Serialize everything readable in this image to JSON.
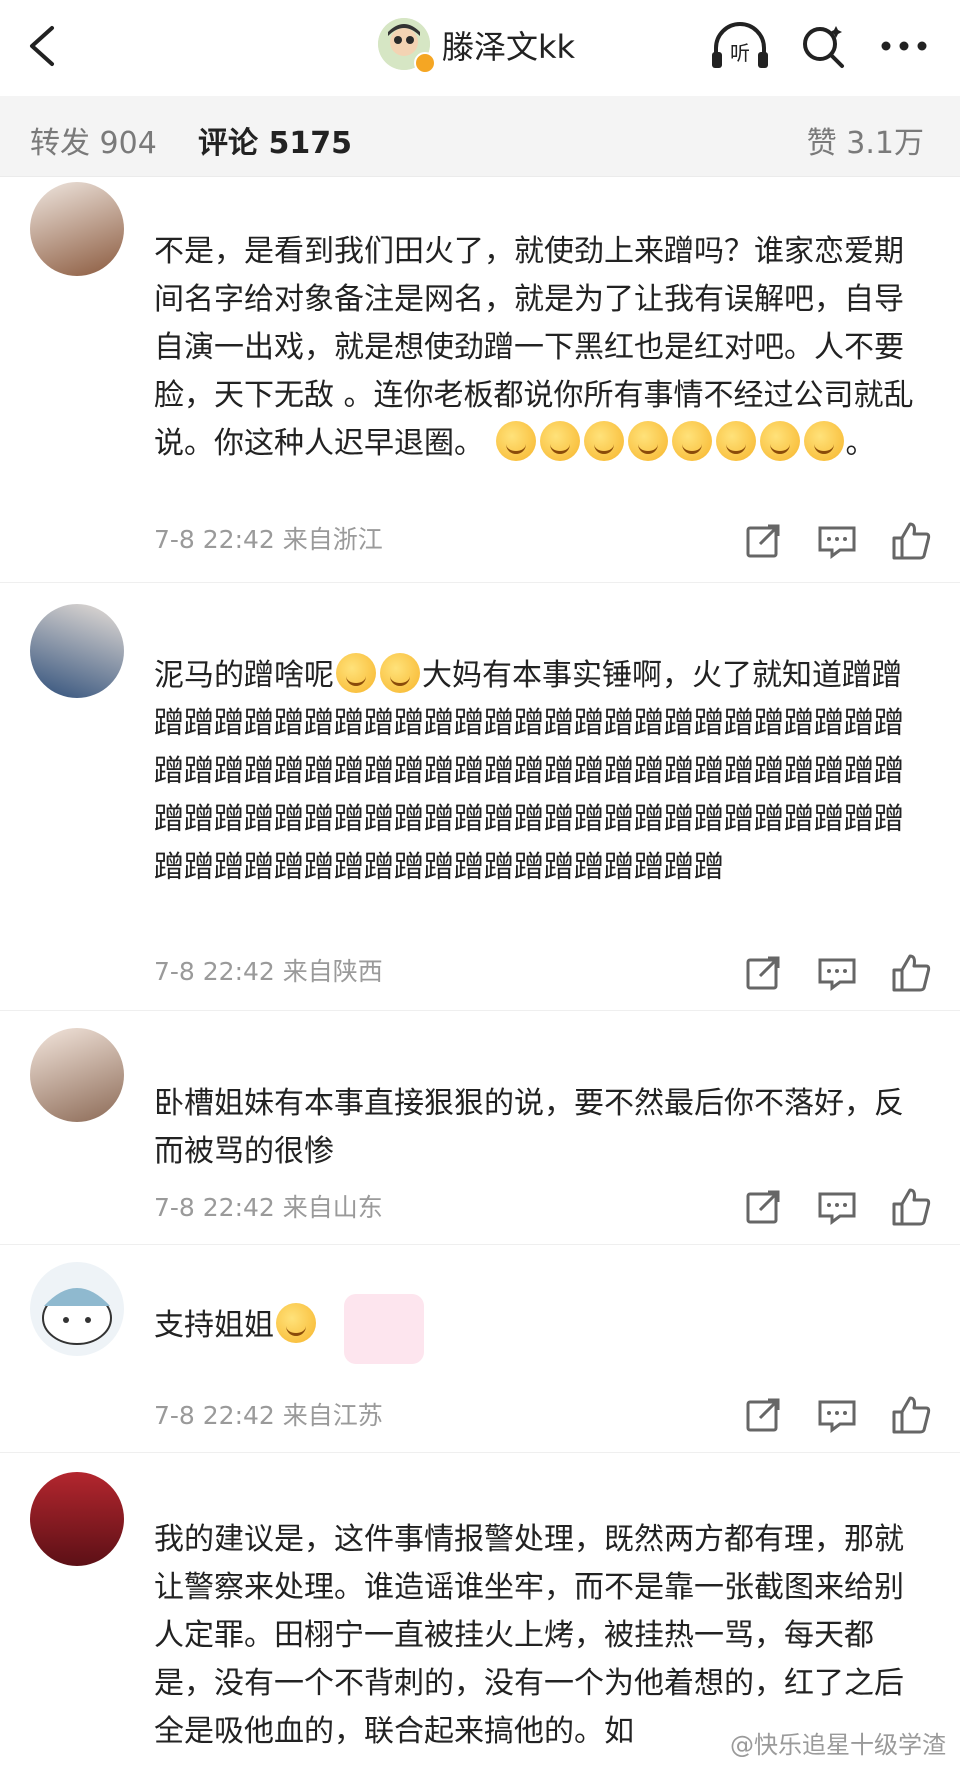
{
  "nav": {
    "title": "滕泽文kk"
  },
  "stats": {
    "repost": "转发 904",
    "comments": "评论 5175",
    "likes": "赞 3.1万"
  },
  "comments": [
    {
      "text": "不是，是看到我们田火了，就使劲上来蹭吗？谁家恋爱期间名字给对象备注是网名，就是为了让我有误解吧，自导自演一出戏，就是想使劲蹭一下黑红也是红对吧。人不要脸，天下无敌 。连你老板都说你所有事情不经过公司就乱说。你这种人迟早退圈。",
      "tail": "。",
      "meta": "7-8 22:42 来自浙江"
    },
    {
      "text_a": "泥马的蹭啥呢",
      "text_b": "大妈有本事实锤啊，火了就知道蹭蹭蹭蹭蹭蹭蹭蹭蹭蹭蹭蹭蹭蹭蹭蹭蹭蹭蹭蹭蹭蹭蹭蹭蹭蹭蹭蹭蹭蹭蹭蹭蹭蹭蹭蹭蹭蹭蹭蹭蹭蹭蹭蹭蹭蹭蹭蹭蹭蹭蹭蹭蹭蹭蹭蹭蹭蹭蹭蹭蹭蹭蹭蹭蹭蹭蹭蹭蹭蹭蹭蹭蹭蹭蹭蹭蹭蹭蹭蹭蹭蹭蹭蹭蹭蹭蹭蹭蹭蹭蹭蹭蹭蹭蹭蹭",
      "meta": "7-8 22:42 来自陕西"
    },
    {
      "text": "卧槽姐妹有本事直接狠狠的说，要不然最后你不落好，反而被骂的很惨",
      "meta": "7-8 22:42 来自山东"
    },
    {
      "text": "支持姐姐",
      "meta": "7-8 22:42 来自江苏"
    },
    {
      "text": "我的建议是，这件事情报警处理，既然两方都有理，那就让警察来处理。谁造谣谁坐牢，而不是靠一张截图来给别人定罪。田栩宁一直被挂火上烤，被挂热一骂，每天都是，没有一个不背刺的，没有一个为他着想的，红了之后全是吸他血的，联合起来搞他的。如"
    }
  ],
  "watermark": "@快乐追星十级学渣"
}
